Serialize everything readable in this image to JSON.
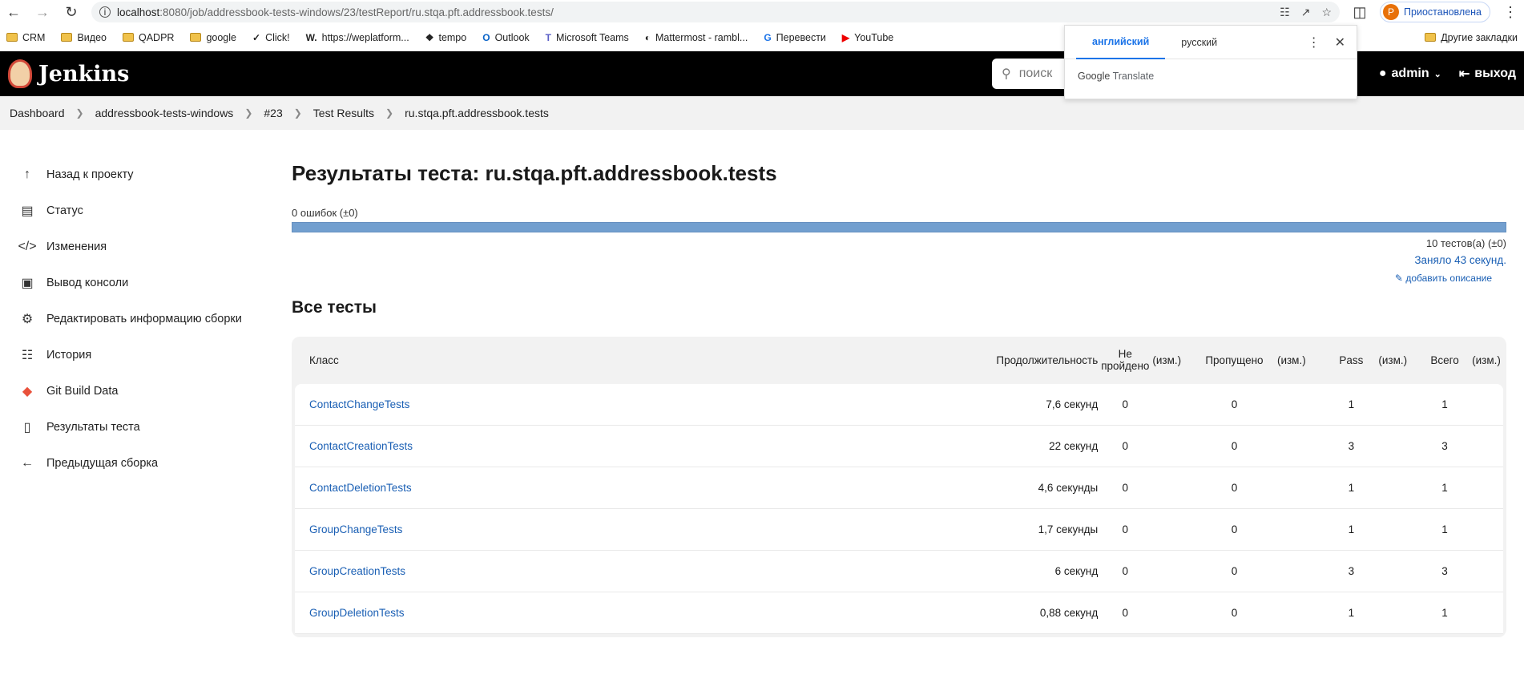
{
  "browser": {
    "url_host": "localhost",
    "url_rest": ":8080/job/addressbook-tests-windows/23/testReport/ru.stqa.pft.addressbook.tests/",
    "profile_status": "Приостановлена",
    "profile_initial": "P",
    "bookmarks": [
      "CRM",
      "Видео",
      "QADPR",
      "google",
      "Click!",
      "https://weplatform...",
      "tempo",
      "Outlook",
      "Microsoft Teams",
      "Mattermost - rambl...",
      "Перевести",
      "YouTube"
    ],
    "other_bookmarks": "Другие закладки"
  },
  "translate": {
    "tab_en": "английский",
    "tab_ru": "русский",
    "brand": "Google",
    "product": "Translate"
  },
  "header": {
    "app_name": "Jenkins",
    "search_placeholder": "поиск",
    "user": "admin",
    "logout": "выход"
  },
  "breadcrumb": [
    "Dashboard",
    "addressbook-tests-windows",
    "#23",
    "Test Results",
    "ru.stqa.pft.addressbook.tests"
  ],
  "sidebar": {
    "items": [
      {
        "label": "Назад к проекту",
        "icon": "arrow-up-icon"
      },
      {
        "label": "Статус",
        "icon": "document-icon"
      },
      {
        "label": "Изменения",
        "icon": "code-icon"
      },
      {
        "label": "Вывод консоли",
        "icon": "terminal-icon"
      },
      {
        "label": "Редактировать информацию сборки",
        "icon": "gear-icon"
      },
      {
        "label": "История",
        "icon": "history-icon"
      },
      {
        "label": "Git Build Data",
        "icon": "git-icon"
      },
      {
        "label": "Результаты теста",
        "icon": "clipboard-icon"
      },
      {
        "label": "Предыдущая сборка",
        "icon": "arrow-left-icon"
      }
    ]
  },
  "main": {
    "title": "Результаты теста: ru.stqa.pft.addressbook.tests",
    "failures": "0 ошибок (±0)",
    "progress_pass_fraction": 1.0,
    "test_count": "10 тестов(а) (±0)",
    "took": "Заняло 43 секунд.",
    "add_description": "добавить описание",
    "section_title": "Все тесты"
  },
  "table": {
    "headers": {
      "cls": "Класс",
      "duration": "Продолжительность",
      "fail_line1": "Не",
      "fail_line2": "пройдено",
      "diff": "(изм.)",
      "skipped": "Пропущено",
      "pass": "Pass",
      "total": "Всего"
    },
    "rows": [
      {
        "cls": "ContactChangeTests",
        "duration": "7,6 секунд",
        "fail": "0",
        "skip": "0",
        "pass": "1",
        "total": "1"
      },
      {
        "cls": "ContactCreationTests",
        "duration": "22 секунд",
        "fail": "0",
        "skip": "0",
        "pass": "3",
        "total": "3"
      },
      {
        "cls": "ContactDeletionTests",
        "duration": "4,6 секунды",
        "fail": "0",
        "skip": "0",
        "pass": "1",
        "total": "1"
      },
      {
        "cls": "GroupChangeTests",
        "duration": "1,7 секунды",
        "fail": "0",
        "skip": "0",
        "pass": "1",
        "total": "1"
      },
      {
        "cls": "GroupCreationTests",
        "duration": "6 секунд",
        "fail": "0",
        "skip": "0",
        "pass": "3",
        "total": "3"
      },
      {
        "cls": "GroupDeletionTests",
        "duration": "0,88 секунд",
        "fail": "0",
        "skip": "0",
        "pass": "1",
        "total": "1"
      }
    ]
  }
}
